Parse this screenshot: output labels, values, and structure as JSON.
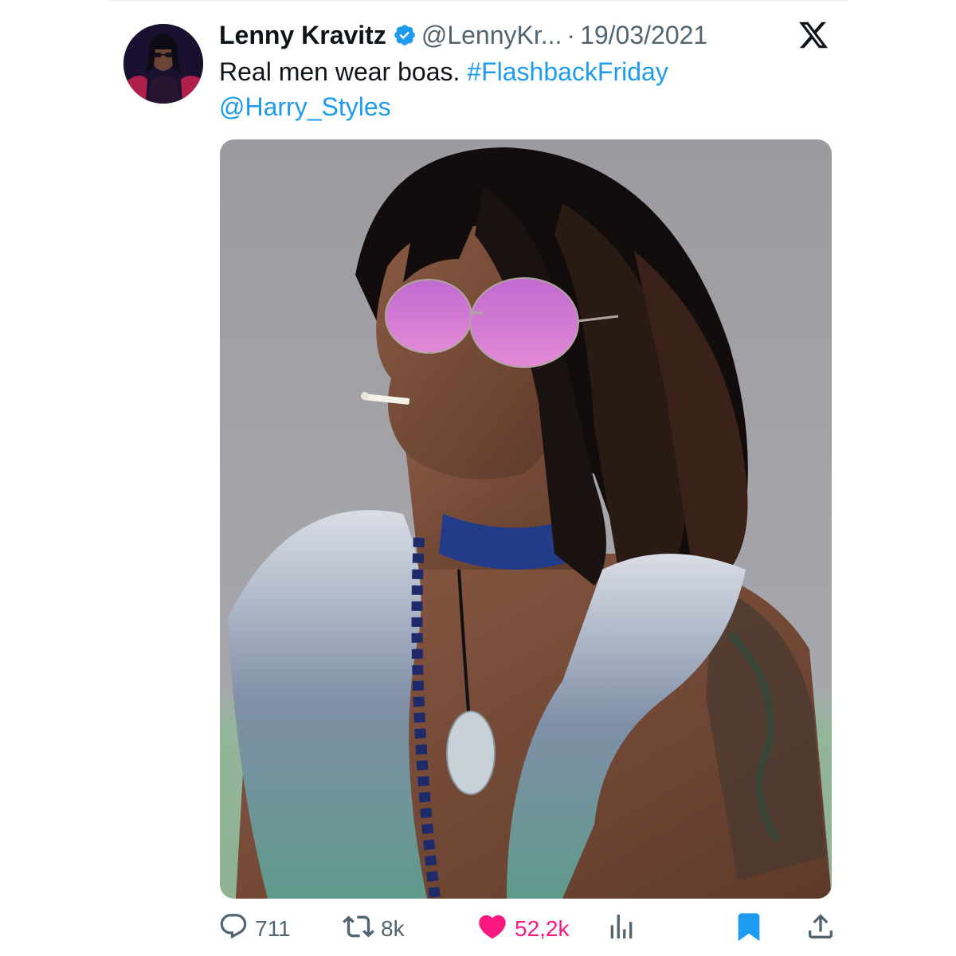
{
  "tweet": {
    "author": {
      "display_name": "Lenny Kravitz",
      "handle": "@LennyKr...",
      "verified": true
    },
    "separator": "·",
    "date": "19/03/2021",
    "text": {
      "plain": "Real men wear boas.",
      "hashtag": "#FlashbackFriday",
      "mention": "@Harry_Styles"
    },
    "stats": {
      "replies": "711",
      "retweets": "8k",
      "likes": "52,2k"
    },
    "liked": true,
    "bookmarked": true
  },
  "icons": {
    "brand": "x-logo-icon",
    "verified": "verified-badge-icon",
    "reply": "reply-icon",
    "retweet": "retweet-icon",
    "like": "heart-icon",
    "views": "views-icon",
    "bookmark": "bookmark-icon",
    "share": "share-icon"
  },
  "colors": {
    "link": "#1d9bf0",
    "like": "#f91880",
    "bookmark": "#1d9bf0",
    "muted": "#536471",
    "text": "#0f1419"
  }
}
